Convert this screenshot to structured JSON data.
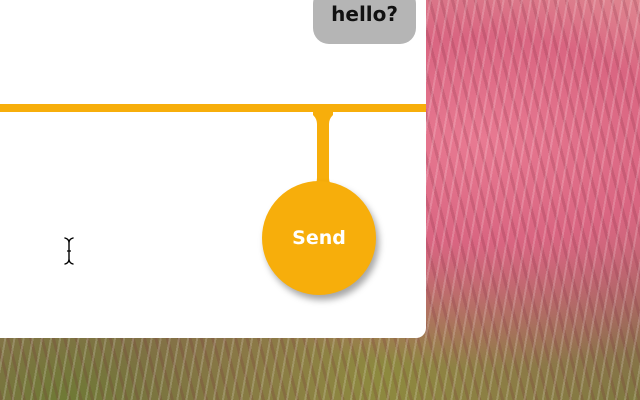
{
  "chat": {
    "messages": [
      {
        "text": "hello?",
        "sender": "other"
      }
    ],
    "input": {
      "value": "",
      "placeholder": ""
    },
    "send_label": "Send"
  },
  "colors": {
    "accent": "#f7ae0b",
    "bubble": "#b5b5b5",
    "panel": "#ffffff"
  },
  "icons": {
    "cursor": "text-cursor-icon"
  }
}
